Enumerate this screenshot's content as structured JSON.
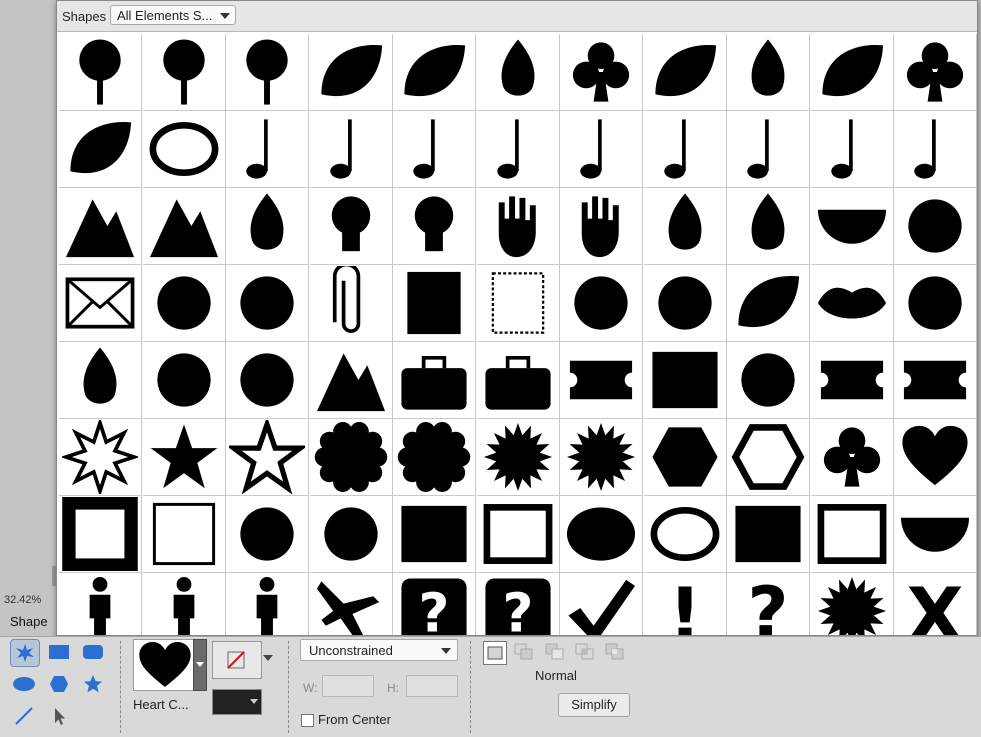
{
  "panel": {
    "label": "Shapes",
    "category": "All Elements S..."
  },
  "shapes": [
    "palm-tree",
    "oak-tree",
    "bare-tree",
    "leaf",
    "marijuana-leaf",
    "simple-leaf",
    "tri-leaf",
    "maple-leaf",
    "holly-leaf",
    "grape-leaf",
    "clover-flower",
    "banana-leaves",
    "oval-frame",
    "half-note",
    "quarter-note",
    "eighth-note",
    "beamed-notes",
    "sixteenth-note",
    "bass-clef",
    "treble-clef",
    "flat-sign",
    "sharp-sign",
    "snowcap-mountain",
    "mountains",
    "tornado",
    "lightbulb",
    "lightbulb-outline",
    "left-hand",
    "right-hand",
    "left-foot",
    "right-foot",
    "umbrella",
    "key",
    "envelope",
    "scissors",
    "scissors-open",
    "paperclip",
    "stamp-filled",
    "stamp-outline",
    "confetti",
    "splatter",
    "holly",
    "lips",
    "candle",
    "hot-air-balloon",
    "tricycle",
    "helicopter",
    "sailboat",
    "briefcase",
    "handbag",
    "ticket",
    "train",
    "bicycle",
    "pointing-hand-right",
    "pointing-hand-left",
    "burst-8",
    "star-5",
    "star-outline",
    "scallop",
    "scallop-outline",
    "starburst",
    "starburst-outline",
    "hexagon",
    "hexagon-outline",
    "club",
    "heart",
    "square-frame",
    "square-frame-thin",
    "diamond-frame",
    "diamond-frame-outline",
    "rounded-frame",
    "rounded-frame-outline",
    "ellipse",
    "ellipse-outline",
    "rectangle",
    "rectangle-outline",
    "half-circle",
    "hiker",
    "woman",
    "man",
    "airplane",
    "question-sign",
    "phone-sign",
    "checkmark",
    "exclamation",
    "question-mark",
    "explosion",
    "x-mark"
  ],
  "status": {
    "zoom": "32.42%",
    "tool_label": "Shape"
  },
  "options": {
    "shape_name": "Heart C...",
    "constraint": "Unconstrained",
    "w_label": "W:",
    "h_label": "H:",
    "w_value": "",
    "h_value": "",
    "from_center": "From Center",
    "blend": "Normal",
    "simplify": "Simplify"
  }
}
